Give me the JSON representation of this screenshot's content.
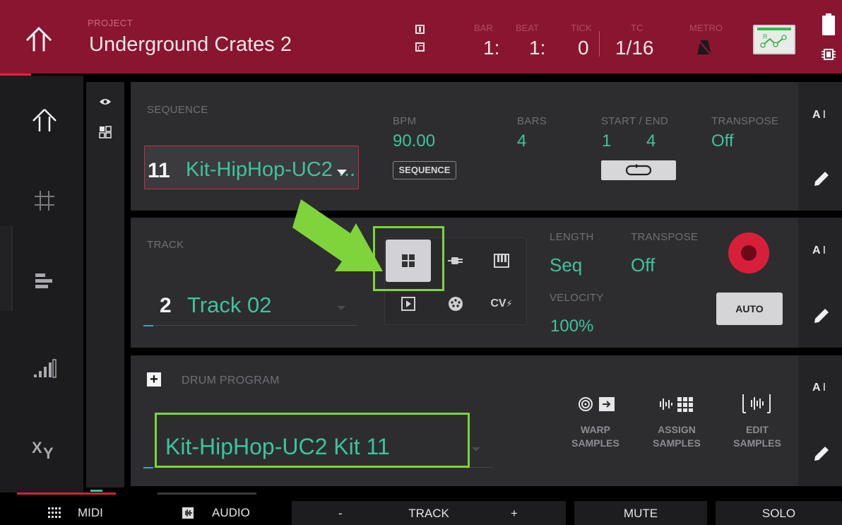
{
  "header": {
    "project_label": "PROJECT",
    "project_name": "Underground Crates 2",
    "bar_label": "BAR",
    "bar_value": "1:",
    "beat_label": "BEAT",
    "beat_value": "1:",
    "tick_label": "TICK",
    "tick_value": "0",
    "tc_label": "TC",
    "tc_value": "1/16",
    "metro_label": "METRO",
    "icons": [
      "home-icon",
      "input-icon",
      "output-icon",
      "metronome-muted-icon",
      "recall-screen-icon",
      "battery-icon",
      "cpu-icon"
    ]
  },
  "sequence": {
    "label": "SEQUENCE",
    "number": "11",
    "name": "Kit-HipHop-UC2 ...",
    "bpm_label": "BPM",
    "bpm_value": "90.00",
    "bars_label": "BARS",
    "bars_value": "4",
    "start_end_label": "START / END",
    "start_value": "1",
    "end_value": "4",
    "transpose_label": "TRANSPOSE",
    "transpose_value": "Off",
    "sequence_button": "SEQUENCE"
  },
  "track": {
    "label": "TRACK",
    "number": "2",
    "name": "Track 02",
    "length_label": "LENGTH",
    "length_value": "Seq",
    "transpose_label": "TRANSPOSE",
    "transpose_value": "Off",
    "velocity_label": "VELOCITY",
    "velocity_value": "100%",
    "auto_button": "AUTO",
    "cv_label": "CV"
  },
  "program": {
    "label": "DRUM PROGRAM",
    "name": "Kit-HipHop-UC2 Kit 11",
    "warp_line1": "WARP",
    "warp_line2": "SAMPLES",
    "assign_line1": "ASSIGN",
    "assign_line2": "SAMPLES",
    "edit_line1": "EDIT",
    "edit_line2": "SAMPLES"
  },
  "side": {
    "ai_label": "A"
  },
  "bottom": {
    "midi": "MIDI",
    "audio": "AUDIO",
    "minus": "-",
    "track": "TRACK",
    "plus": "+",
    "mute": "MUTE",
    "solo": "SOLO"
  },
  "colors": {
    "header_bg": "#8a1530",
    "accent_teal": "#3fc39c",
    "record_red": "#d81f3a",
    "highlight_green": "#7ed43a"
  }
}
